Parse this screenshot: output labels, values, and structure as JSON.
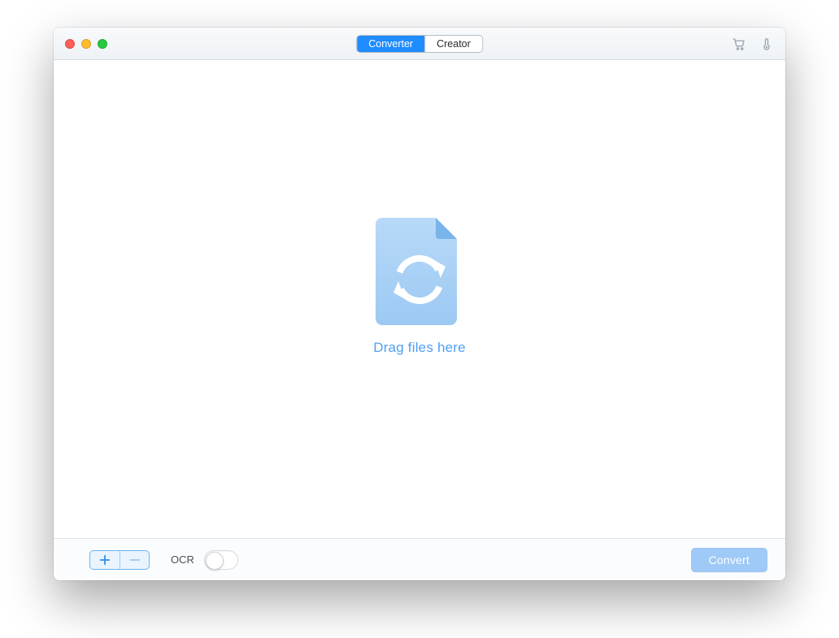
{
  "titlebar": {
    "tabs": {
      "converter": "Converter",
      "creator": "Creator",
      "active": "converter"
    },
    "icons": {
      "cart": "cart-icon",
      "temperature": "thermometer-icon"
    }
  },
  "main": {
    "drop_caption": "Drag files here"
  },
  "footer": {
    "ocr_label": "OCR",
    "ocr_on": false,
    "convert_label": "Convert"
  },
  "colors": {
    "accent": "#1f8cff",
    "accent_light": "#9fc9f6",
    "drop_blue": "#8ebdf0"
  }
}
